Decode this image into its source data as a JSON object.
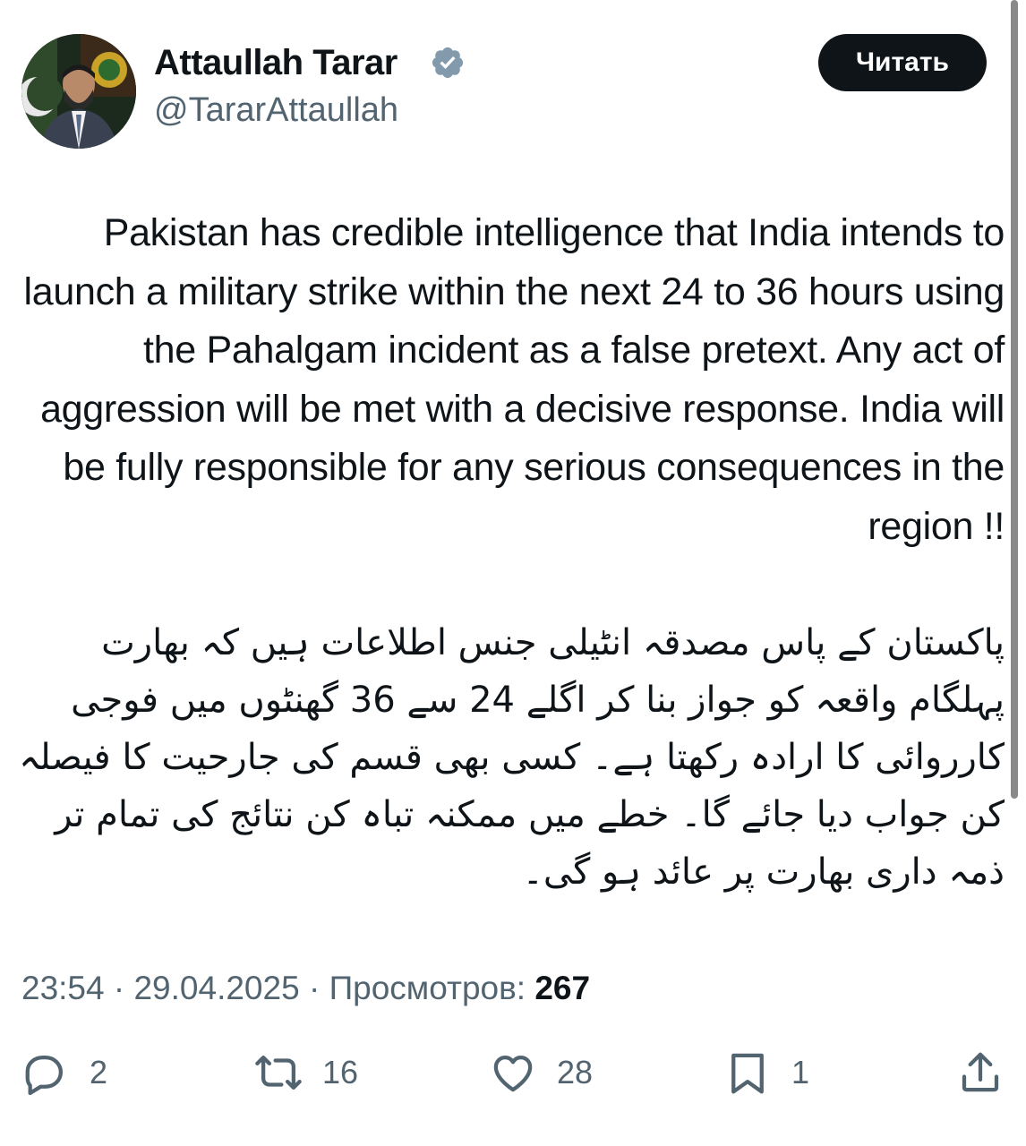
{
  "author": {
    "name": "Attaullah Tarar",
    "handle": "@TararAttaullah",
    "verified": true
  },
  "follow_button": {
    "label": "Читать"
  },
  "tweet": {
    "text_en": "Pakistan has credible intelligence that India intends to launch a military strike within the next 24 to 36 hours using the Pahalgam incident as a false pretext. Any act of aggression will be met with a decisive response. India will be fully responsible for any serious consequences in the region !!",
    "text_ur": "پاکستان کے پاس مصدقہ انٹیلی جنس اطلاعات ہیں کہ بھارت پہلگام واقعہ کو جواز بنا کر اگلے 24 سے 36 گھنٹوں میں فوجی کارروائی کا ارادہ رکھتا ہے۔ کسی بھی قسم کی جارحیت کا فیصلہ کن جواب دیا جائے گا۔ خطے میں ممکنہ تباہ کن نتائج کی تمام تر ذمہ داری بھارت پر عائد ہو گی۔"
  },
  "meta": {
    "time": "23:54",
    "separator": "·",
    "date": "29.04.2025",
    "views_label": "Просмотров:",
    "views_count": "267"
  },
  "actions": {
    "replies": "2",
    "reposts": "16",
    "likes": "28",
    "bookmarks": "1"
  },
  "icons": {
    "reply": "reply-icon",
    "repost": "repost-icon",
    "like": "heart-icon",
    "bookmark": "bookmark-icon",
    "share": "share-icon",
    "verified": "verified-badge-icon"
  },
  "colors": {
    "text": "#0f1419",
    "secondary": "#536471",
    "verified": "#829aab",
    "button_bg": "#0f1419"
  }
}
